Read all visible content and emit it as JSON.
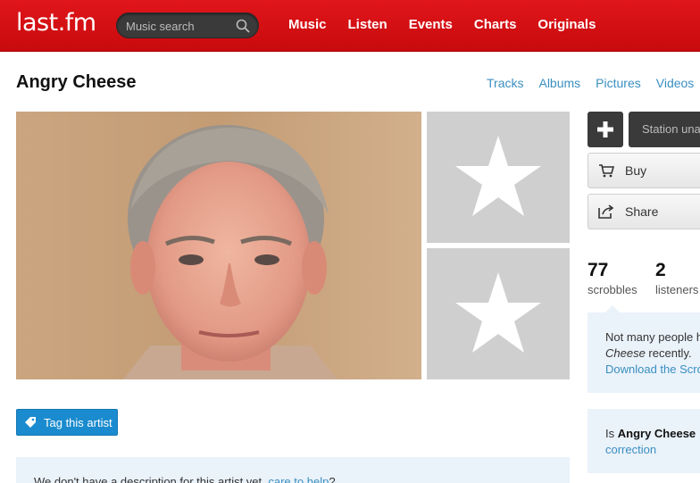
{
  "header": {
    "logo": "last.fm",
    "search_placeholder": "Music search",
    "nav": [
      "Music",
      "Listen",
      "Events",
      "Charts",
      "Originals"
    ]
  },
  "artist": {
    "name": "Angry Cheese",
    "tabs": [
      "Tracks",
      "Albums",
      "Pictures",
      "Videos"
    ]
  },
  "actions": {
    "add_icon": "plus-icon",
    "station_label": "Station una",
    "buy_label": "Buy",
    "share_label": "Share",
    "tag_label": "Tag this artist"
  },
  "stats": {
    "scrobbles_value": "77",
    "scrobbles_label": "scrobbles",
    "listeners_value": "2",
    "listeners_label": "listeners"
  },
  "info_box": {
    "line1": "Not many people h",
    "line2_italic": "Cheese",
    "line2_rest": " recently.",
    "line3_link": "Download the Scro"
  },
  "correction_box": {
    "line1_prefix": "Is ",
    "line1_bold": "Angry Cheese",
    "line2_link": "correction"
  },
  "description": {
    "text": "We don't have a description for this artist yet, ",
    "link": "care to help",
    "suffix": "?"
  },
  "colors": {
    "header_red": "#d51007",
    "link_blue": "#3a8fc0",
    "tag_button_blue": "#1a8bce",
    "info_bg": "#eaf2fa"
  }
}
